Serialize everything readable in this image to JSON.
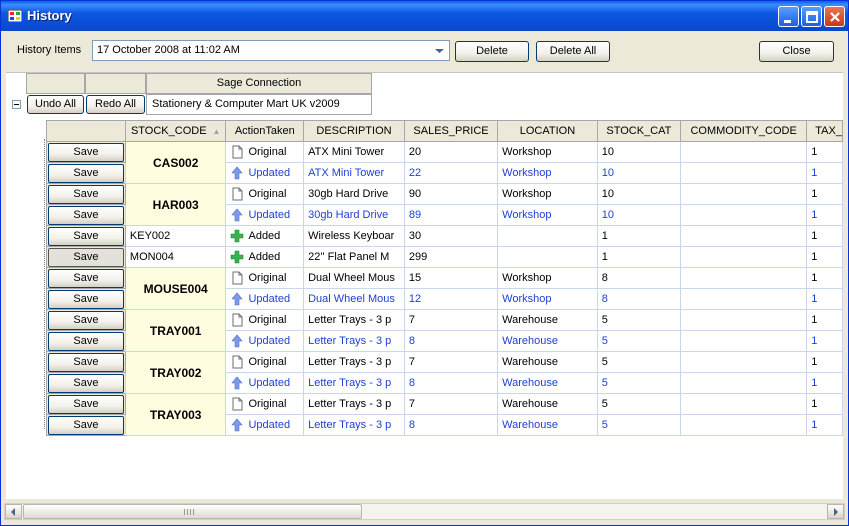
{
  "window": {
    "title": "History",
    "accent": "#0a4fd6"
  },
  "top_bar": {
    "history_label": "History Items",
    "history_selected": "17 October 2008 at 11:02 AM",
    "delete_label": "Delete",
    "delete_all_label": "Delete All",
    "close_label": "Close"
  },
  "connection": {
    "header": "Sage Connection",
    "undo_all_label": "Undo All",
    "redo_all_label": "Redo All",
    "name": "Stationery & Computer Mart UK  v2009"
  },
  "grid": {
    "columns": [
      "STOCK_CODE",
      "ActionTaken",
      "DESCRIPTION",
      "SALES_PRICE",
      "LOCATION",
      "STOCK_CAT",
      "COMMODITY_CODE",
      "TAX_"
    ],
    "save_label": "Save",
    "groups": [
      {
        "code": "CAS002",
        "rows": [
          {
            "action": "Original",
            "icon": "document-icon",
            "description": "ATX Mini Tower",
            "sales_price": "20",
            "location": "Workshop",
            "stock_cat": "10",
            "commodity_code": "",
            "tax": "1"
          },
          {
            "action": "Updated",
            "icon": "up-arrow-icon",
            "description": "ATX Mini Tower",
            "sales_price": "22",
            "location": "Workshop",
            "stock_cat": "10",
            "commodity_code": "",
            "tax": "1"
          }
        ]
      },
      {
        "code": "HAR003",
        "rows": [
          {
            "action": "Original",
            "icon": "document-icon",
            "description": "30gb Hard Drive",
            "sales_price": "90",
            "location": "Workshop",
            "stock_cat": "10",
            "commodity_code": "",
            "tax": "1"
          },
          {
            "action": "Updated",
            "icon": "up-arrow-icon",
            "description": "30gb Hard Drive",
            "sales_price": "89",
            "location": "Workshop",
            "stock_cat": "10",
            "commodity_code": "",
            "tax": "1"
          }
        ]
      },
      {
        "code": "KEY002",
        "plain": true,
        "rows": [
          {
            "action": "Added",
            "icon": "plus-icon",
            "description": "Wireless Keyboar",
            "sales_price": "30",
            "location": "",
            "stock_cat": "1",
            "commodity_code": "",
            "tax": "1"
          }
        ]
      },
      {
        "code": "MON004",
        "plain": true,
        "rows": [
          {
            "action": "Added",
            "icon": "plus-icon",
            "description": "22'' Flat Panel M",
            "sales_price": "299",
            "location": "",
            "stock_cat": "1",
            "commodity_code": "",
            "tax": "1"
          }
        ]
      },
      {
        "code": "MOUSE004",
        "rows": [
          {
            "action": "Original",
            "icon": "document-icon",
            "description": "Dual Wheel Mous",
            "sales_price": "15",
            "location": "Workshop",
            "stock_cat": "8",
            "commodity_code": "",
            "tax": "1"
          },
          {
            "action": "Updated",
            "icon": "up-arrow-icon",
            "description": "Dual Wheel Mous",
            "sales_price": "12",
            "location": "Workshop",
            "stock_cat": "8",
            "commodity_code": "",
            "tax": "1"
          }
        ]
      },
      {
        "code": "TRAY001",
        "rows": [
          {
            "action": "Original",
            "icon": "document-icon",
            "description": "Letter Trays - 3 p",
            "sales_price": "7",
            "location": "Warehouse",
            "stock_cat": "5",
            "commodity_code": "",
            "tax": "1"
          },
          {
            "action": "Updated",
            "icon": "up-arrow-icon",
            "description": "Letter Trays - 3 p",
            "sales_price": "8",
            "location": "Warehouse",
            "stock_cat": "5",
            "commodity_code": "",
            "tax": "1"
          }
        ]
      },
      {
        "code": "TRAY002",
        "rows": [
          {
            "action": "Original",
            "icon": "document-icon",
            "description": "Letter Trays - 3 p",
            "sales_price": "7",
            "location": "Warehouse",
            "stock_cat": "5",
            "commodity_code": "",
            "tax": "1"
          },
          {
            "action": "Updated",
            "icon": "up-arrow-icon",
            "description": "Letter Trays - 3 p",
            "sales_price": "8",
            "location": "Warehouse",
            "stock_cat": "5",
            "commodity_code": "",
            "tax": "1"
          }
        ]
      },
      {
        "code": "TRAY003",
        "rows": [
          {
            "action": "Original",
            "icon": "document-icon",
            "description": "Letter Trays - 3 p",
            "sales_price": "7",
            "location": "Warehouse",
            "stock_cat": "5",
            "commodity_code": "",
            "tax": "1"
          },
          {
            "action": "Updated",
            "icon": "up-arrow-icon",
            "description": "Letter Trays - 3 p",
            "sales_price": "8",
            "location": "Warehouse",
            "stock_cat": "5",
            "commodity_code": "",
            "tax": "1"
          }
        ]
      }
    ]
  }
}
